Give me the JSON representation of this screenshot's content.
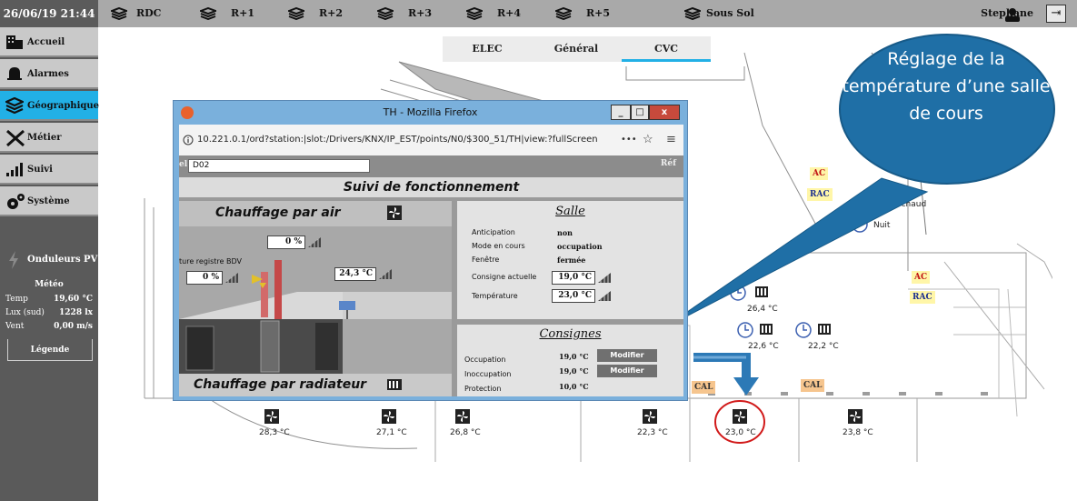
{
  "topbar": {
    "datetime": "26/06/19 21:44",
    "floors": [
      "RDC",
      "R+1",
      "R+2",
      "R+3",
      "R+4",
      "R+5",
      "Sous Sol"
    ],
    "user": "Stephane"
  },
  "sidebar": {
    "items": [
      {
        "label": "Accueil",
        "icon": "building-icon"
      },
      {
        "label": "Alarmes",
        "icon": "bell-icon"
      },
      {
        "label": "Géographique",
        "icon": "layers-icon"
      },
      {
        "label": "Métier",
        "icon": "tools-icon"
      },
      {
        "label": "Suivi",
        "icon": "bars-chart-icon"
      },
      {
        "label": "Système",
        "icon": "gears-icon"
      }
    ],
    "active_index": 2,
    "pv_title": "Onduleurs PV",
    "meteo_title": "Météo",
    "meteo": [
      {
        "key": "Temp",
        "value": "19,60 °C"
      },
      {
        "key": "Lux (sud)",
        "value": "1228 lx"
      },
      {
        "key": "Vent",
        "value": "0,00 m/s"
      }
    ],
    "legend_label": "Légende"
  },
  "plan": {
    "tabs": [
      "ELEC",
      "Général",
      "CVC"
    ],
    "active_tab": 2,
    "rooms_bottom": [
      {
        "temp": "28,3 °C"
      },
      {
        "temp": "27,1 °C"
      },
      {
        "temp": "26,8 °C"
      },
      {
        "temp": "22,3 °C"
      },
      {
        "temp": "23,0 °C",
        "highlighted": true
      },
      {
        "temp": "23,8 °C"
      }
    ],
    "rooms_mid": [
      {
        "temp": "26,4 °C"
      },
      {
        "temp": "22,6 °C"
      },
      {
        "temp": "22,2 °C"
      }
    ],
    "labels": {
      "rideau": "ideau d'air chaud",
      "nuit": "Nuit",
      "cal": "CAL",
      "rac": "RAC",
      "ac": "AC"
    }
  },
  "callout": {
    "text": "Réglage de la température d’une salle de cours"
  },
  "popup": {
    "title": "TH - Mozilla Firefox",
    "url": "10.221.0.1/ord?station:|slot:/Drivers/KNX/IP_EST/points/N0/$300_51/TH|view:?fullScreen",
    "url_more": "•••",
    "room_prefix": "el",
    "room_value": "D02",
    "ref_label": "Réf",
    "monitoring_title": "Suivi de fonctionnement",
    "air": {
      "title": "Chauffage par air",
      "registre_label": "ture registre BDV",
      "val_top": "0 %",
      "val_left": "0 %",
      "val_right": "24,3 °C"
    },
    "radiator_title": "Chauffage par radiateur",
    "salle": {
      "title": "Salle",
      "rows": [
        {
          "key": "Anticipation",
          "value": "non"
        },
        {
          "key": "Mode en cours",
          "value": "occupation"
        },
        {
          "key": "Fenêtre",
          "value": "fermée"
        },
        {
          "key": "Consigne actuelle",
          "value": "19,0 °C"
        },
        {
          "key": "Température",
          "value": "23,0 °C"
        }
      ]
    },
    "consignes": {
      "title": "Consignes",
      "rows": [
        {
          "key": "Occupation",
          "value": "19,0 °C",
          "button": "Modifier"
        },
        {
          "key": "Inoccupation",
          "value": "19,0 °C",
          "button": "Modifier"
        },
        {
          "key": "Protection",
          "value": "10,0 °C"
        }
      ]
    }
  },
  "colors": {
    "accent": "#22b0e6",
    "callout": "#1f6fa6",
    "highlight_circle": "#d11a1a",
    "arrow": "#2c79b6"
  }
}
